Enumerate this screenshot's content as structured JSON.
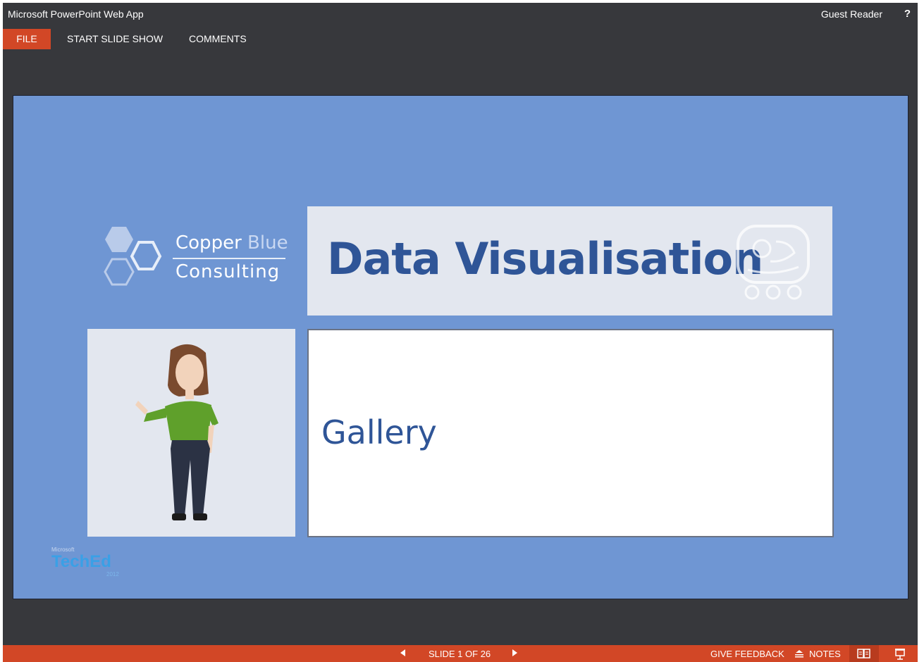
{
  "app": {
    "title": "Microsoft PowerPoint Web App",
    "user": "Guest Reader",
    "help": "?"
  },
  "menu": {
    "file": "FILE",
    "start_slide_show": "START SLIDE SHOW",
    "comments": "COMMENTS"
  },
  "slide": {
    "logo_word1": "Copper",
    "logo_word2": "Blue",
    "logo_line2": "Consulting",
    "title": "Data Visualisation",
    "subtitle": "Gallery",
    "event_brand_small": "Microsoft",
    "event_brand": "TechEd",
    "event_year": "2012"
  },
  "status": {
    "prev_icon": "triangle-left-icon",
    "slide_counter": "SLIDE 1 OF 26",
    "next_icon": "triangle-right-icon",
    "feedback": "GIVE FEEDBACK",
    "notes": "NOTES",
    "reading_view_icon": "book-icon",
    "slideshow_icon": "presentation-icon"
  },
  "colors": {
    "accent": "#d24726",
    "chrome": "#37383c",
    "slide_bg": "#6f96d3",
    "title_color": "#2f5597"
  }
}
